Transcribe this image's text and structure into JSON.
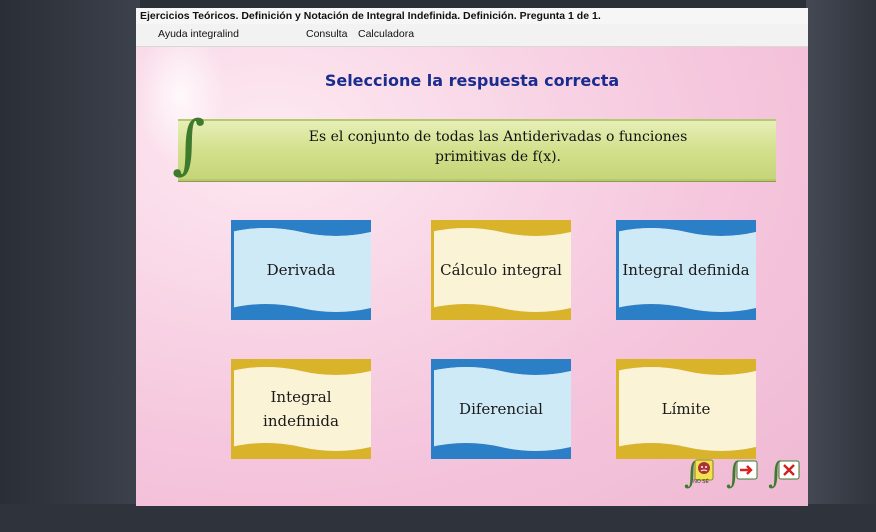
{
  "window": {
    "title": "Ejercicios Teóricos. Definición y Notación de Integral Indefinida. Definición. Pregunta 1 de 1.",
    "menu": [
      "Ayuda integralind",
      "Consulta",
      "Calculadora"
    ]
  },
  "prompt": "Seleccione la respuesta correcta",
  "question": {
    "line1": "Es el conjunto de todas las Antiderivadas o funciones",
    "line2": "primitivas de f(x)."
  },
  "options": [
    {
      "label": "Derivada",
      "style": "blue"
    },
    {
      "label": "Cálculo integral",
      "style": "gold"
    },
    {
      "label": "Integral definida",
      "style": "blue"
    },
    {
      "label": "Integral indefinida",
      "style": "gold"
    },
    {
      "label": "Diferencial",
      "style": "blue"
    },
    {
      "label": "Límite",
      "style": "gold"
    }
  ],
  "colors": {
    "blue_band": "#2a7fc7",
    "blue_fill": "#cfeaf7",
    "gold_band": "#d9b42a",
    "gold_fill": "#fbf3d6",
    "prompt": "#1a2c8e",
    "panel": "#d3e08d"
  },
  "footer": {
    "no_se_label": "NO SÉ",
    "icons": [
      "dont-know-icon",
      "next-arrow-icon",
      "close-icon"
    ]
  }
}
